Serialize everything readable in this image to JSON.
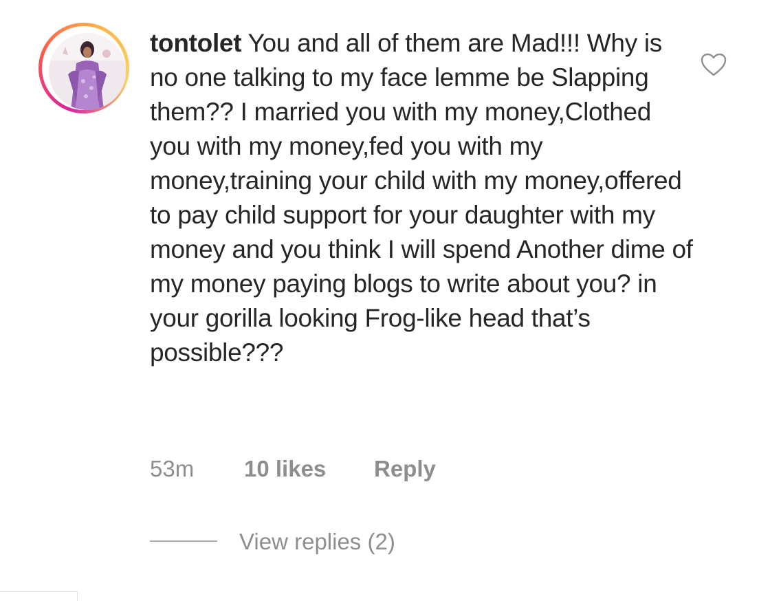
{
  "comment": {
    "username": "tontolet",
    "text": "You and all of them are Mad!!! Why is no one talking to my face lemme be Slapping them?? I married you with my money,Clothed you with my money,fed you with my money,training your child with my money,offered to pay child support for your daughter with my money and you think I will spend Another dime of my money paying blogs to write about you? in your gorilla looking Frog-like head that’s possible???",
    "time": "53m",
    "likes": "10 likes",
    "reply_label": "Reply",
    "view_replies": "View replies (2)",
    "avatar_icon": "profile-photo",
    "like_icon": "heart-outline-icon"
  },
  "colors": {
    "text": "#262626",
    "meta": "#8e8e8e",
    "story_ring": [
      "#d6249f",
      "#fd5949",
      "#fdb349"
    ]
  }
}
